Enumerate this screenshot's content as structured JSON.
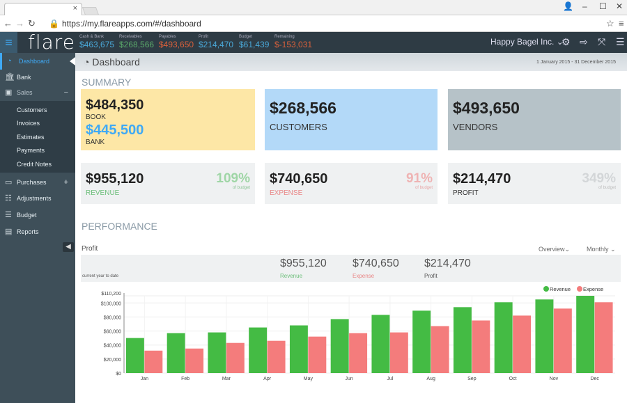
{
  "browser": {
    "url": "https://my.flareapps.com/#/dashboard",
    "tab_close": "×"
  },
  "topbar": {
    "logo": "flare",
    "kpis": [
      {
        "label": "Cash & Bank",
        "value": "$463,675",
        "color": "#4aa8d8"
      },
      {
        "label": "Receivables",
        "value": "$268,566",
        "color": "#5aa86a"
      },
      {
        "label": "Payables",
        "value": "$493,650",
        "color": "#d9603b"
      },
      {
        "label": "Profit",
        "value": "$214,470",
        "color": "#4aa8d8"
      },
      {
        "label": "Budget",
        "value": "$61,439",
        "color": "#4aa8d8"
      },
      {
        "label": "Remaining",
        "value": "$-153,031",
        "color": "#d9603b"
      }
    ],
    "company": "Happy Bagel Inc. ⌄"
  },
  "sidebar": {
    "items": [
      {
        "label": "Dashboard",
        "icon": "dashboard-icon"
      },
      {
        "label": "Bank",
        "icon": "bank-icon"
      },
      {
        "label": "Sales",
        "icon": "money-icon",
        "toggle": "−"
      },
      {
        "label": "Purchases",
        "icon": "card-icon",
        "toggle": "+"
      },
      {
        "label": "Adjustments",
        "icon": "sliders-icon"
      },
      {
        "label": "Budget",
        "icon": "budget-icon"
      },
      {
        "label": "Reports",
        "icon": "clipboard-icon"
      }
    ],
    "sales_sub": [
      "Customers",
      "Invoices",
      "Estimates",
      "Payments",
      "Credit Notes"
    ]
  },
  "header": {
    "title": "Dashboard",
    "date_range": "1 January 2015 - 31 December 2015"
  },
  "summary": {
    "title": "SUMMARY",
    "book": {
      "value": "$484,350",
      "label": "BOOK",
      "bank_value": "$445,500",
      "bank_label": "BANK"
    },
    "customers": {
      "value": "$268,566",
      "label": "CUSTOMERS"
    },
    "vendors": {
      "value": "$493,650",
      "label": "VENDORS"
    },
    "revenue": {
      "value": "$955,120",
      "label": "REVENUE",
      "pct": "109%",
      "of": "of budget"
    },
    "expense": {
      "value": "$740,650",
      "label": "EXPENSE",
      "pct": "91%",
      "of": "of budget"
    },
    "profit": {
      "value": "$214,470",
      "label": "PROFIT",
      "pct": "349%",
      "of": "of budget"
    }
  },
  "performance": {
    "title": "PERFORMANCE",
    "subtitle": "Profit",
    "overview": "Overview⌄",
    "period": "Monthly ⌄",
    "ytd_label": "current year to date",
    "revenue": {
      "value": "$955,120",
      "label": "Revenue"
    },
    "expense": {
      "value": "$740,650",
      "label": "Expense"
    },
    "profit": {
      "value": "$214,470",
      "label": "Profit"
    }
  },
  "chart_data": {
    "type": "bar",
    "categories": [
      "Jan",
      "Feb",
      "Mar",
      "Apr",
      "May",
      "Jun",
      "Jul",
      "Aug",
      "Sep",
      "Oct",
      "Nov",
      "Dec"
    ],
    "series": [
      {
        "name": "Revenue",
        "color": "#44bb44",
        "values": [
          50000,
          57000,
          58000,
          65000,
          68000,
          77000,
          83000,
          89000,
          94000,
          101000,
          105000,
          110200
        ]
      },
      {
        "name": "Expense",
        "color": "#f47c7c",
        "values": [
          32000,
          35000,
          43000,
          46000,
          52000,
          57000,
          58000,
          67000,
          75000,
          82000,
          92000,
          101000
        ]
      }
    ],
    "yticks": [
      "$0",
      "$20,000",
      "$40,000",
      "$60,000",
      "$80,000",
      "$100,000",
      "$110,200"
    ],
    "ytick_values": [
      0,
      20000,
      40000,
      60000,
      80000,
      100000,
      110200
    ],
    "ylim": [
      0,
      110200
    ],
    "grid": true,
    "legend": "top-right"
  }
}
